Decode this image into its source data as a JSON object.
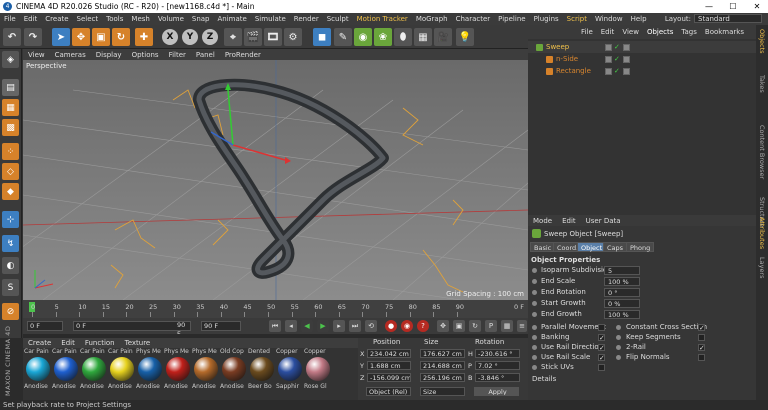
{
  "window": {
    "title": "CINEMA 4D R20.026 Studio (RC - R20) - [new1168.c4d *] - Main",
    "logo_glyph": "4",
    "controls": [
      "—",
      "☐",
      "✕"
    ]
  },
  "menubar": {
    "items": [
      "File",
      "Edit",
      "Create",
      "Select",
      "Tools",
      "Mesh",
      "Volume",
      "Snap",
      "Animate",
      "Simulate",
      "Render",
      "Sculpt",
      "Motion Tracker",
      "MoGraph",
      "Character",
      "Pipeline",
      "Plugins",
      "Script",
      "Window",
      "Help"
    ],
    "highlighted": [
      "Motion Tracker",
      "Script"
    ],
    "layout_label": "Layout:",
    "layout_value": "Standard"
  },
  "toolbar": {
    "axis_buttons": [
      "X",
      "Y",
      "Z"
    ],
    "icons": [
      "undo-icon",
      "live-selection-icon",
      "move-icon",
      "scale-icon",
      "rotate-icon",
      "recent-tools-icon",
      "x-axis-icon",
      "y-axis-icon",
      "z-axis-icon",
      "coordinate-system-icon",
      "render-view-icon",
      "render-picture-viewer-icon",
      "render-settings-icon",
      "cube-icon",
      "pen-icon",
      "subdivision-icon",
      "array-icon",
      "deformer-icon",
      "floor-icon",
      "camera-icon",
      "light-icon"
    ]
  },
  "viewport": {
    "menu": [
      "View",
      "Cameras",
      "Display",
      "Options",
      "Filter",
      "Panel",
      "ProRender"
    ],
    "label": "Perspective",
    "grid_spacing": "Grid Spacing : 100 cm"
  },
  "timeline": {
    "ticks": [
      "0",
      "5",
      "10",
      "15",
      "20",
      "25",
      "30",
      "35",
      "40",
      "45",
      "50",
      "55",
      "60",
      "65",
      "70",
      "75",
      "80",
      "85",
      "90"
    ],
    "end_marker": "0 F"
  },
  "playback": {
    "start_frame": "0 F",
    "current_frame": "0 F",
    "end_frame": "90 F",
    "end_frame2": "90 F"
  },
  "materials": {
    "menu": [
      "Create",
      "Edit",
      "Function",
      "Texture"
    ],
    "items": [
      {
        "top": "Car Pain",
        "bottom": "Anodise",
        "color": "#1aa7d6"
      },
      {
        "top": "Car Pain",
        "bottom": "Anodise",
        "color": "#1e5fcf"
      },
      {
        "top": "Car Pain",
        "bottom": "Anodise",
        "color": "#2fa83d"
      },
      {
        "top": "Car Pain",
        "bottom": "Anodise",
        "color": "#e7d21e"
      },
      {
        "top": "Phys Me",
        "bottom": "Anodise",
        "color": "#1760a8"
      },
      {
        "top": "Phys Me",
        "bottom": "Anodise",
        "color": "#c0201a"
      },
      {
        "top": "Phys Me",
        "bottom": "Anodise",
        "color": "#b46a2a"
      },
      {
        "top": "Old Cop",
        "bottom": "Anodise",
        "color": "#7a3c22"
      },
      {
        "top": "Dented",
        "bottom": "Beer Bo",
        "color": "#6b4b1e"
      },
      {
        "top": "Copper",
        "bottom": "Sapphir",
        "color": "#2b4ea0"
      },
      {
        "top": "Copper",
        "bottom": "Rose Gl",
        "color": "#c27a86"
      }
    ],
    "brand": "MAXON CINEMA 4D"
  },
  "coordinates": {
    "headers": [
      "Position",
      "Size",
      "Rotation"
    ],
    "rows": [
      {
        "axis": "X",
        "pos": "234.042 cm",
        "size": "176.627 cm",
        "rlabel": "H",
        "rot": "-230.616 °"
      },
      {
        "axis": "Y",
        "pos": "1.688 cm",
        "size": "214.688 cm",
        "rlabel": "P",
        "rot": "7.02 °"
      },
      {
        "axis": "Z",
        "pos": "-156.099 cm",
        "size": "256.196 cm",
        "rlabel": "B",
        "rot": "-3.846 °"
      }
    ],
    "mode": "Object (Rel)",
    "size_mode": "Size",
    "apply": "Apply"
  },
  "objects": {
    "menu": [
      "File",
      "Edit",
      "View",
      "Objects",
      "Tags",
      "Bookmarks"
    ],
    "active_menu": "Objects",
    "items": [
      {
        "name": "Sweep",
        "color": "#f0c14b",
        "indent": 0
      },
      {
        "name": "n-Side",
        "color": "#d8862f",
        "indent": 1
      },
      {
        "name": "Rectangle",
        "color": "#d8862f",
        "indent": 1
      }
    ]
  },
  "side_tabs": {
    "top": [
      "Objects",
      "Takes",
      "Content Browser",
      "Structure"
    ],
    "bottom": [
      "Attributes",
      "Layers"
    ]
  },
  "attributes": {
    "menu": [
      "Mode",
      "Edit",
      "User Data"
    ],
    "title": "Sweep Object [Sweep]",
    "tabs": [
      "Basic",
      "Coord.",
      "Object",
      "Caps",
      "Phong"
    ],
    "active_tab": "Object",
    "section": "Object Properties",
    "fields": [
      {
        "label": "Isoparm Subdivision",
        "value": "5"
      },
      {
        "label": "End Scale",
        "value": "100 %"
      },
      {
        "label": "End Rotation",
        "value": "0 °"
      },
      {
        "label": "Start Growth",
        "value": "0 %"
      },
      {
        "label": "End Growth",
        "value": "100 %"
      }
    ],
    "checks_left": [
      {
        "label": "Parallel Movement",
        "checked": false
      },
      {
        "label": "Banking",
        "checked": true
      },
      {
        "label": "Use Rail Direction",
        "checked": true
      },
      {
        "label": "Use Rail Scale",
        "checked": true
      },
      {
        "label": "Stick UVs",
        "checked": false
      }
    ],
    "checks_right": [
      {
        "label": "Constant Cross Section",
        "checked": true
      },
      {
        "label": "Keep Segments",
        "checked": false
      },
      {
        "label": "2-Rail",
        "checked": true
      },
      {
        "label": "Flip Normals",
        "checked": false
      }
    ],
    "details": "Details"
  },
  "status": {
    "text": "Set playback rate to Project Settings"
  }
}
